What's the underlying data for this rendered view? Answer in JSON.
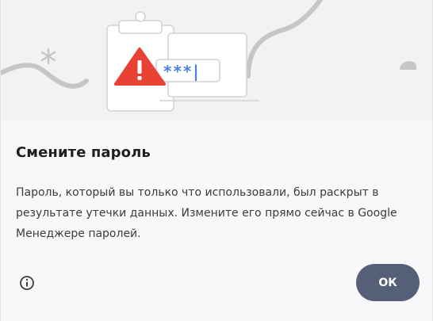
{
  "dialog": {
    "illustration": {
      "password_mask": "***|",
      "icons": [
        "clipboard-icon",
        "warning-triangle-icon",
        "password-field-icon",
        "asterisk-icon"
      ]
    },
    "title": "Смените пароль",
    "body": "Пароль, который вы только что использовали, был раскрыт в результате утечки данных. Измените его прямо сейчас в Google Менеджере паролей.",
    "info_icon": "info-icon",
    "ok_label": "ОК"
  },
  "colors": {
    "accent_button": "#556078",
    "warning_red": "#e94235",
    "password_blue": "#4c7fe5",
    "hero_background": "#f2f1f4"
  }
}
